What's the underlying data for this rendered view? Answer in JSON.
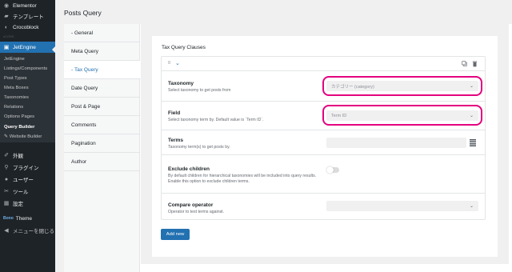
{
  "sidebar": {
    "top_items": [
      {
        "label": "Elementor",
        "icon": "elementor-icon"
      },
      {
        "label": "テンプレート",
        "icon": "folder-icon"
      },
      {
        "label": "Crocoblock",
        "icon": "crocoblock-icon"
      }
    ],
    "separator_label": "#CORE",
    "active_item": {
      "label": "JetEngine",
      "icon": "jetengine-icon"
    },
    "sub_items": [
      "JetEngine",
      "Listings/Components",
      "Post Types",
      "Meta Boxes",
      "Taxonomies",
      "Relations",
      "Options Pages",
      "Query Builder",
      "Website Builder"
    ],
    "bottom_items": [
      {
        "label": "外観",
        "icon": "brush-icon"
      },
      {
        "label": "プラグイン",
        "icon": "plugin-icon"
      },
      {
        "label": "ユーザー",
        "icon": "user-icon"
      },
      {
        "label": "ツール",
        "icon": "wrench-icon"
      },
      {
        "label": "設定",
        "icon": "settings-icon"
      },
      {
        "label": "Theme",
        "icon": "bono-logo"
      },
      {
        "label": "メニューを閉じる",
        "icon": "collapse-icon"
      }
    ],
    "theme_brand": "Bono"
  },
  "page": {
    "title": "Posts Query"
  },
  "tabs": [
    "General",
    "Meta Query",
    "Tax Query",
    "Date Query",
    "Post & Page",
    "Comments",
    "Pagination",
    "Author"
  ],
  "tax_query": {
    "section_title": "Tax Query Clauses",
    "clause_index": "0",
    "fields": {
      "taxonomy": {
        "label": "Taxonomy",
        "desc": "Select taxonomy to get posts from",
        "value": "カテゴリー (category)"
      },
      "field": {
        "label": "Field",
        "desc": "Select taxonomy term by. Default value is `Term ID`.",
        "value": "Term ID"
      },
      "terms": {
        "label": "Terms",
        "desc": "Taxonomy term(s) to get posts by."
      },
      "exclude_children": {
        "label": "Exclude children",
        "desc": "By default children for hierarchical taxonomies will be included into query results. Enable this option to exclude children terms.",
        "enabled": false
      },
      "compare_operator": {
        "label": "Compare operator",
        "desc": "Operator to test terms against.",
        "value": ""
      }
    },
    "add_new_label": "Add new",
    "highlight_color": "#e4007f",
    "accent_color": "#2271b1"
  }
}
